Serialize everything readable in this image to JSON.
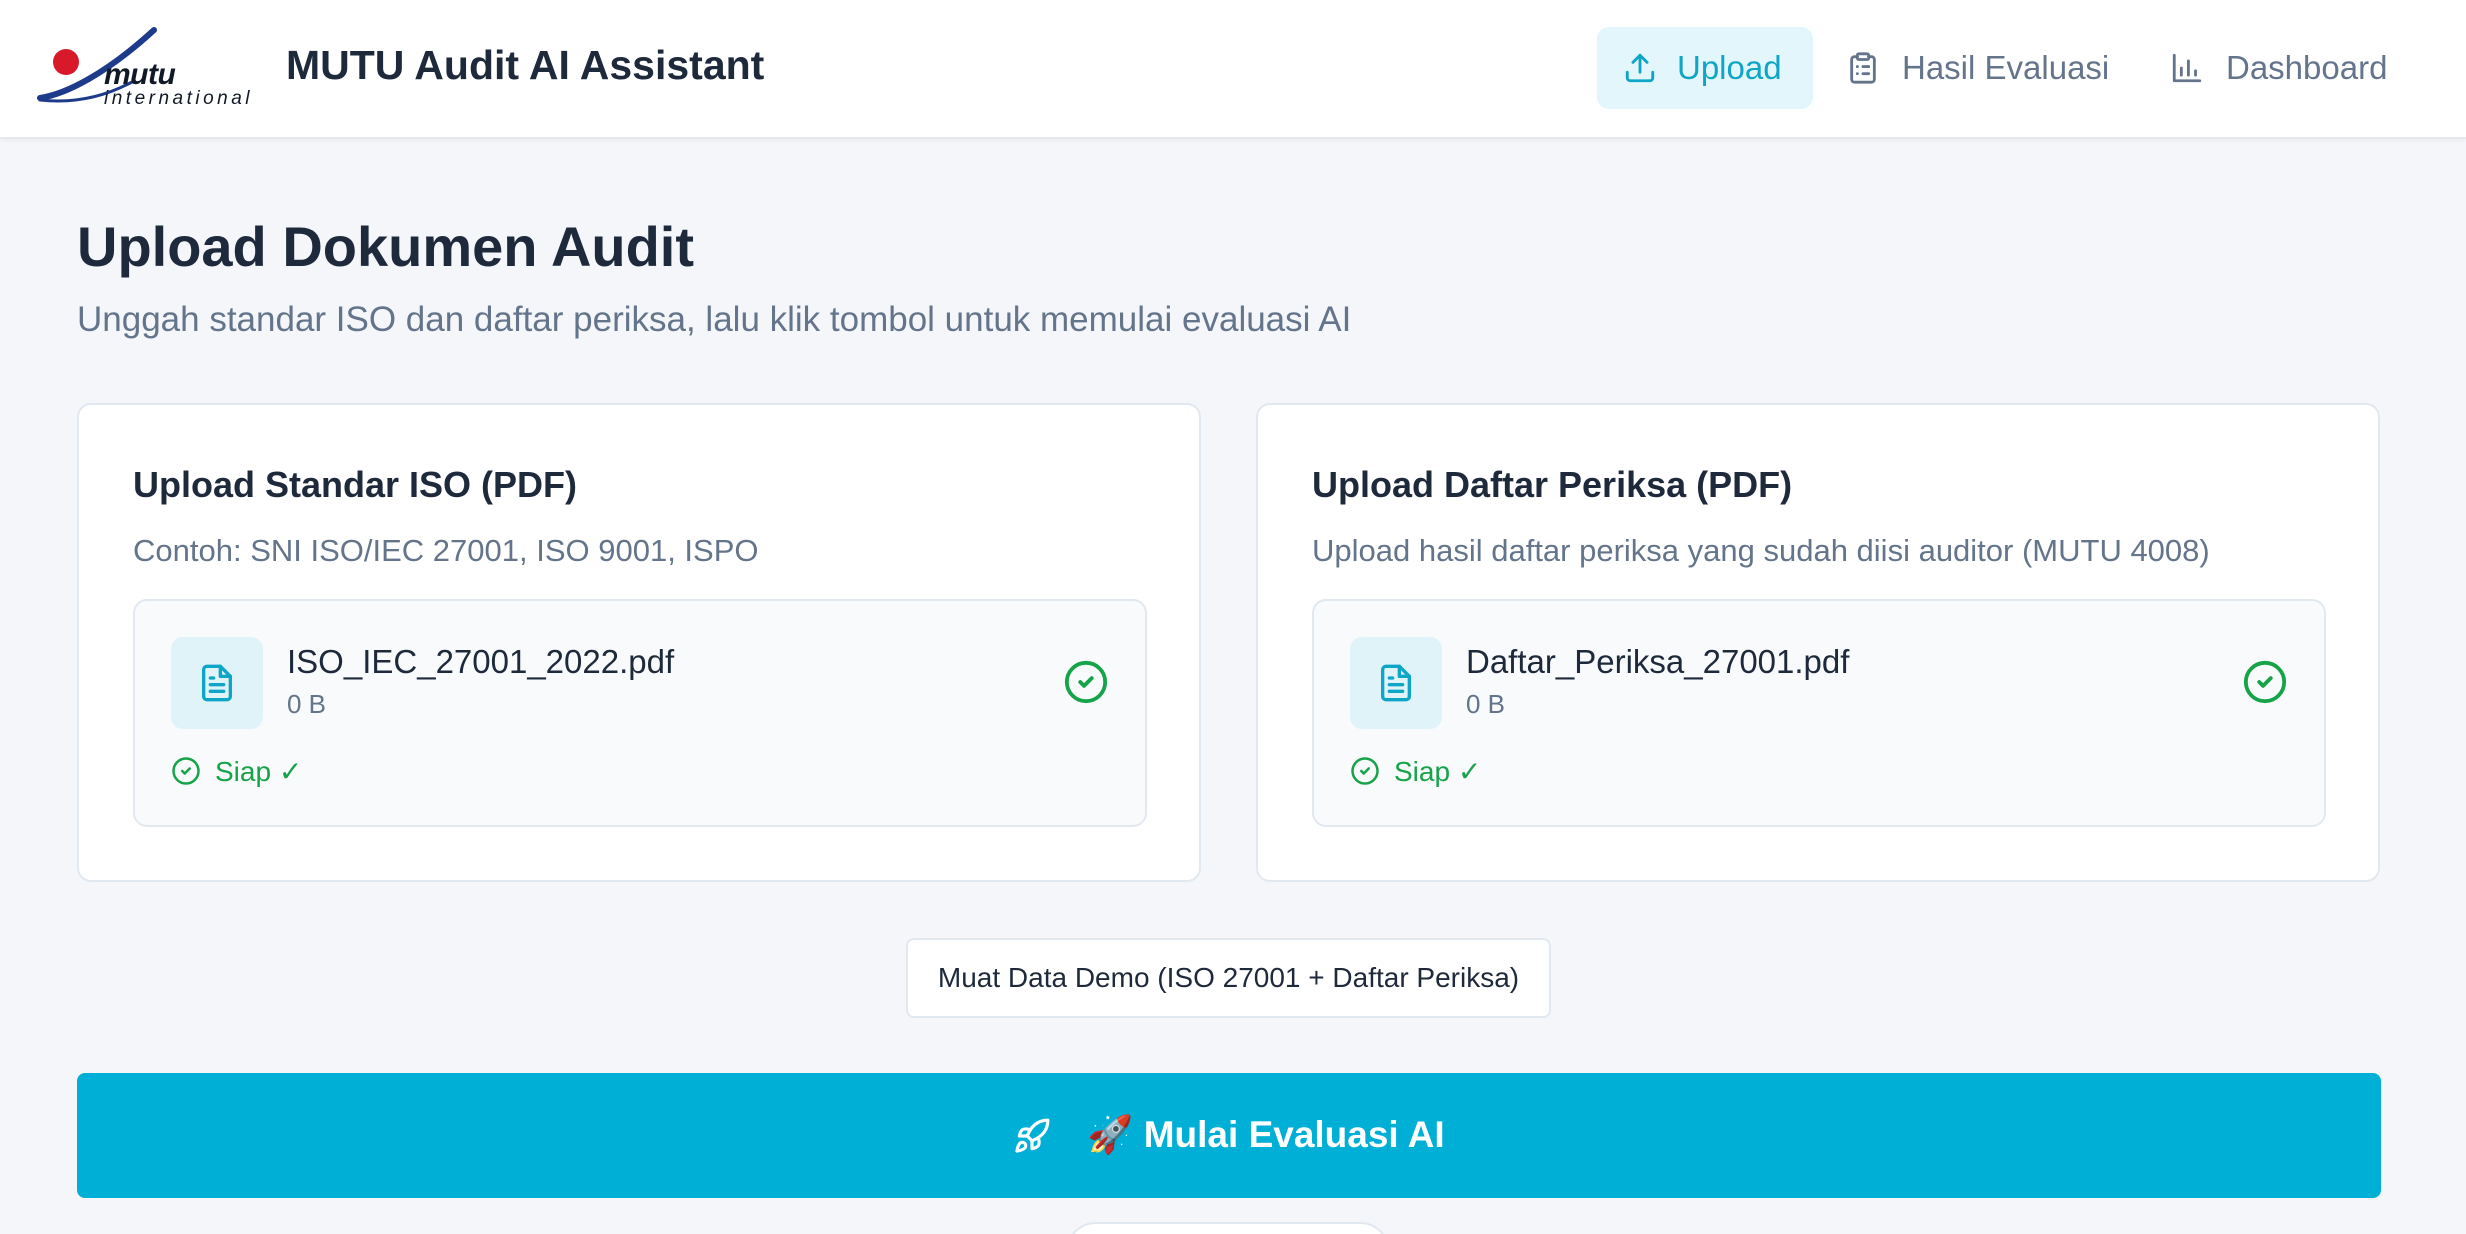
{
  "header": {
    "logo": {
      "brand": "mutu",
      "tagline": "international"
    },
    "app_title": "MUTU Audit AI Assistant",
    "nav": [
      {
        "label": "Upload",
        "icon": "upload-icon",
        "active": true
      },
      {
        "label": "Hasil Evaluasi",
        "icon": "clipboard-list-icon",
        "active": false
      },
      {
        "label": "Dashboard",
        "icon": "bar-chart-icon",
        "active": false
      }
    ]
  },
  "page": {
    "title": "Upload Dokumen Audit",
    "subtitle": "Unggah standar ISO dan daftar periksa, lalu klik tombol untuk memulai evaluasi AI"
  },
  "cards": [
    {
      "title": "Upload Standar ISO (PDF)",
      "description": "Contoh: SNI ISO/IEC 27001, ISO 9001, ISPO",
      "file": {
        "name": "ISO_IEC_27001_2022.pdf",
        "size": "0 B",
        "icon": "file-text-icon"
      },
      "status": "Siap ✓"
    },
    {
      "title": "Upload Daftar Periksa (PDF)",
      "description": "Upload hasil daftar periksa yang sudah diisi auditor (MUTU 4008)",
      "file": {
        "name": "Daftar_Periksa_27001.pdf",
        "size": "0 B",
        "icon": "file-text-icon"
      },
      "status": "Siap ✓"
    }
  ],
  "demo_button": {
    "label": "Muat Data Demo (ISO 27001 + Daftar Periksa)"
  },
  "primary_button": {
    "label": "🚀 Mulai Evaluasi AI",
    "icon": "rocket-icon"
  },
  "colors": {
    "accent": "#00afd6",
    "accent_light": "#e2f6fb",
    "success": "#16a34a",
    "logo_red": "#d7192a",
    "logo_blue": "#1e3a8a"
  }
}
